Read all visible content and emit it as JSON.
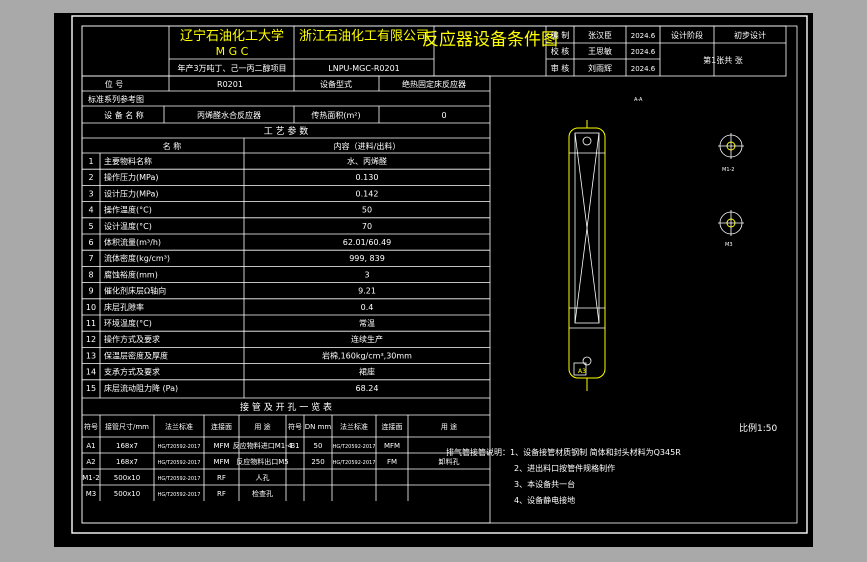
{
  "title_block": {
    "university": "辽宁石油化工大学",
    "mgc": "M G C",
    "company": "浙江石油化工有限公司",
    "drawing_title": "反应器设备条件图",
    "project": "年产3万吨丁、己一丙二醇项目",
    "drawing_no": "LNPU-MGC-R0201",
    "roles": [
      {
        "role": "编 制",
        "name": "张汉臣",
        "date": "2024.6"
      },
      {
        "role": "校 核",
        "name": "王思敏",
        "date": "2024.6"
      },
      {
        "role": "审 核",
        "name": "刘雨辉",
        "date": "2024.6"
      }
    ],
    "stage_label": "设计阶段",
    "stage_value": "初步设计",
    "sheet_info": "第1张共 张"
  },
  "info_rows": {
    "position_label": "位 号",
    "position_value": "R0201",
    "type_label": "设备型式",
    "type_value": "绝热固定床反应器",
    "standard_label": "标准系列参考图",
    "name_label": "设 备 名 称",
    "name_value": "丙烯醛水合反应器",
    "area_label": "传热面积(m²)",
    "area_value": "0"
  },
  "process_params": {
    "section_title": "工 艺 参 数",
    "col_name": "名 称",
    "col_content": "内容（进料/出料）",
    "rows": [
      {
        "no": "1",
        "name": "主要物料名称",
        "value": "水、丙烯醛"
      },
      {
        "no": "2",
        "name": "操作压力(MPa)",
        "value": "0.130"
      },
      {
        "no": "3",
        "name": "设计压力(MPa)",
        "value": "0.142"
      },
      {
        "no": "4",
        "name": "操作温度(°C)",
        "value": "50"
      },
      {
        "no": "5",
        "name": "设计温度(°C)",
        "value": "70"
      },
      {
        "no": "6",
        "name": "体积流量(m³/h)",
        "value": "62.01/60.49"
      },
      {
        "no": "7",
        "name": "流体密度(kg/cm³)",
        "value": "999, 839"
      },
      {
        "no": "8",
        "name": "腐蚀裕度(mm)",
        "value": "3"
      },
      {
        "no": "9",
        "name": "催化剂床层Ω轴向",
        "value": "9.21"
      },
      {
        "no": "10",
        "name": "床层孔隙率",
        "value": "0.4"
      },
      {
        "no": "11",
        "name": "环境温度(°C)",
        "value": "常温"
      },
      {
        "no": "12",
        "name": "操作方式及要求",
        "value": "连续生产"
      },
      {
        "no": "13",
        "name": "保温层密度及厚度",
        "value": "岩棉,160kg/cm³,30mm"
      },
      {
        "no": "14",
        "name": "支承方式及要求",
        "value": "裙座"
      },
      {
        "no": "15",
        "name": "床层流动阻力降 (Pa)",
        "value": "68.24"
      }
    ]
  },
  "nozzles": {
    "section_title": "接 管 及 开 孔 一 览 表",
    "headers": [
      "符号",
      "接管尺寸/mm",
      "法兰标准",
      "连接面",
      "用 途",
      "符号",
      "DN mm",
      "法兰标准",
      "连接面",
      "用 途"
    ],
    "rows": [
      {
        "sym": "A1",
        "size": "168x7",
        "std": "HG/T20592-2017",
        "face": "MFM",
        "use": "反应物料进口M1-4",
        "sym2": "B1",
        "dn": "50",
        "std2": "HG/T20592-2017",
        "face2": "MFM",
        "use2": ""
      },
      {
        "sym": "A2",
        "size": "168x7",
        "std": "HG/T20592-2017",
        "face": "MFM",
        "use": "反应物料出口M5",
        "sym2": "",
        "dn": "250",
        "std2": "HG/T20592-2017",
        "face2": "FM",
        "use2": "卸料孔"
      },
      {
        "sym": "M1-2",
        "size": "500x10",
        "std": "HG/T20592-2017",
        "face": "RF",
        "use": "人孔",
        "sym2": "",
        "dn": "",
        "std2": "",
        "face2": "",
        "use2": ""
      },
      {
        "sym": "M3",
        "size": "500x10",
        "std": "HG/T20592-2017",
        "face": "RF",
        "use": "检查孔",
        "sym2": "",
        "dn": "",
        "std2": "",
        "face2": "",
        "use2": ""
      }
    ]
  },
  "notes": [
    "排气管接管说明：1、设备接管材质钢制   简体和封头材料为Q345R",
    "2、进出料口按管件规格制作",
    "3、本设备共一台",
    "4、设备静电接地"
  ],
  "drawing": {
    "scale": "比例1:50",
    "view_label": "A-A",
    "detail1_label": "M1-2",
    "detail2_label": "M3",
    "bottom_label": "A3"
  }
}
